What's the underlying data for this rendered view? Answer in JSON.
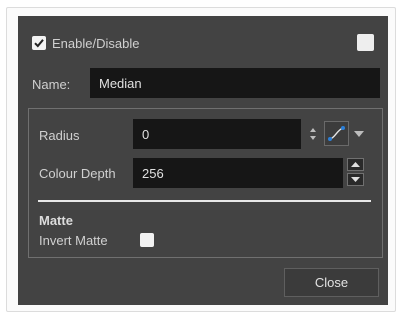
{
  "dialog": {
    "enable_label": "Enable/Disable",
    "enable_checked": true,
    "name_label": "Name:",
    "name_value": "Median",
    "radius_label": "Radius",
    "radius_value": "0",
    "colour_depth_label": "Colour Depth",
    "colour_depth_value": "256",
    "matte_heading": "Matte",
    "invert_matte_label": "Invert Matte",
    "invert_matte_checked": false,
    "close_label": "Close"
  },
  "colors": {
    "dialog_bg": "#434343",
    "field_bg": "#161616",
    "function_accent": "#2b7fd8"
  }
}
